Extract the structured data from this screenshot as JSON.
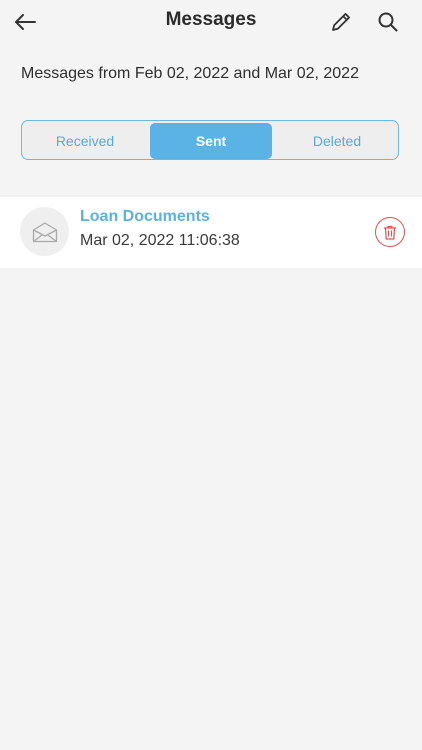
{
  "header": {
    "title": "Messages",
    "back_icon": "arrow-left-icon",
    "edit_icon": "pencil-icon",
    "search_icon": "search-icon"
  },
  "date_range": "Messages from Feb 02, 2022 and Mar 02, 2022",
  "tabs": [
    {
      "label": "Received",
      "selected": false
    },
    {
      "label": "Sent",
      "selected": true
    },
    {
      "label": "Deleted",
      "selected": false
    }
  ],
  "messages": [
    {
      "subject": "Loan Documents",
      "date": "Mar 02, 2022 11:06:38",
      "icon": "envelope-open-icon",
      "action_icon": "trash-icon"
    }
  ],
  "colors": {
    "accent": "#5bb3e5",
    "delete": "#d9534f",
    "background": "#f4f4f4"
  }
}
